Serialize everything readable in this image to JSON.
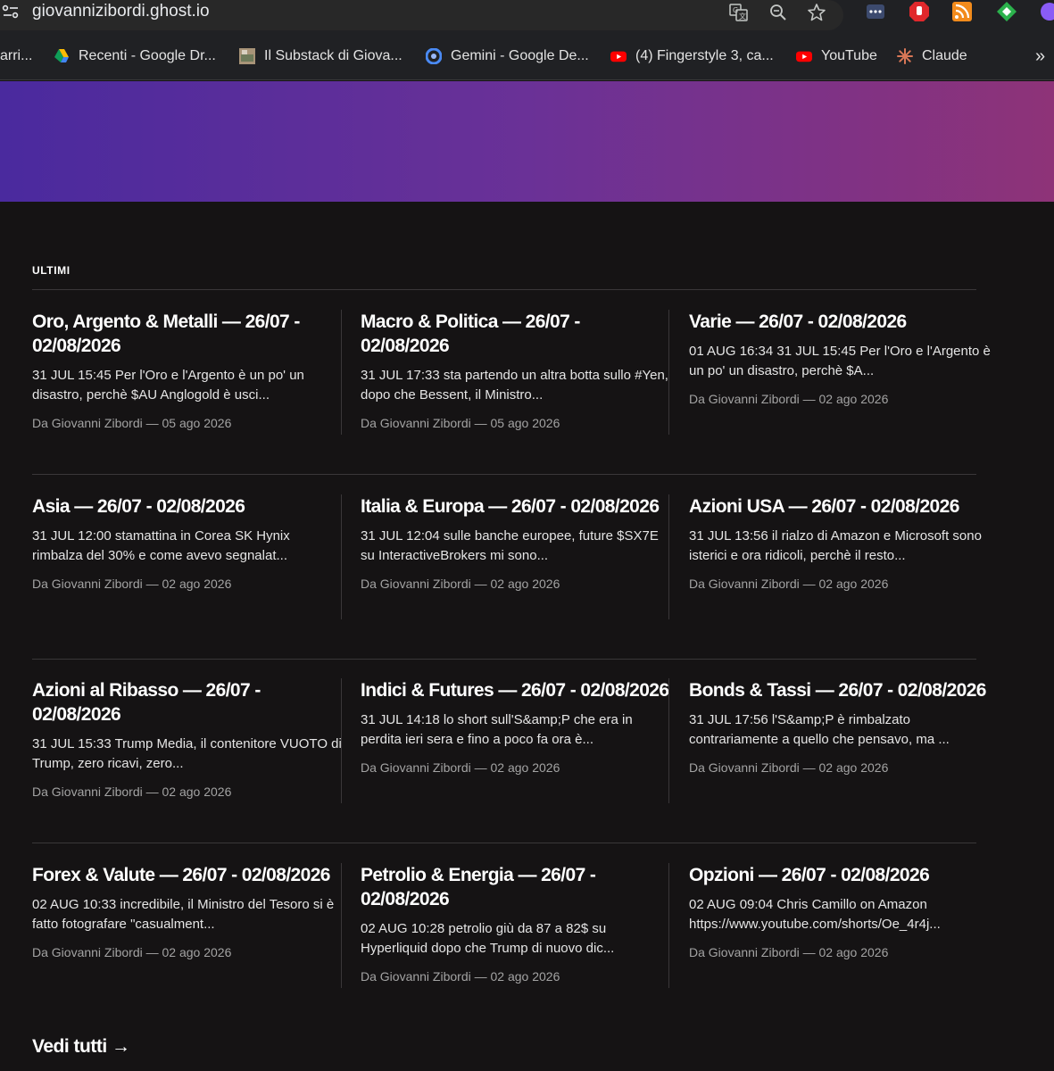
{
  "browser": {
    "url": "giovannizibordi.ghost.io",
    "bookmarks": [
      {
        "label": "arri..."
      },
      {
        "label": "Recenti - Google Dr..."
      },
      {
        "label": "Il Substack di Giova..."
      },
      {
        "label": "Gemini - Google De..."
      },
      {
        "label": "(4) Fingerstyle 3, ca..."
      },
      {
        "label": "YouTube"
      },
      {
        "label": "Claude"
      }
    ],
    "overflow_label": "»"
  },
  "section": {
    "title": "ULTIMI"
  },
  "posts": [
    {
      "title": "Oro, Argento & Metalli — 26/07 - 02/08/2026",
      "excerpt": "31 JUL 15:45 Per l'Oro e l'Argento è un po' un disastro, perchè $AU Anglogold è usci...",
      "meta": "Da Giovanni Zibordi — 05 ago 2026"
    },
    {
      "title": "Macro & Politica — 26/07 - 02/08/2026",
      "excerpt": "31 JUL 17:33 sta partendo un altra botta sullo #Yen, dopo che Bessent, il Ministro...",
      "meta": "Da Giovanni Zibordi — 05 ago 2026"
    },
    {
      "title": "Varie — 26/07 - 02/08/2026",
      "excerpt": "01 AUG 16:34 31 JUL 15:45 Per l'Oro e l'Argento è un po' un disastro, perchè $A...",
      "meta": "Da Giovanni Zibordi — 02 ago 2026"
    },
    {
      "title": "Asia — 26/07 - 02/08/2026",
      "excerpt": "31 JUL 12:00 stamattina in Corea SK Hynix rimbalza del 30% e come avevo segnalat...",
      "meta": "Da Giovanni Zibordi — 02 ago 2026"
    },
    {
      "title": "Italia & Europa — 26/07 - 02/08/2026",
      "excerpt": "31 JUL 12:04 sulle banche europee, future $SX7E su InteractiveBrokers mi sono...",
      "meta": "Da Giovanni Zibordi — 02 ago 2026"
    },
    {
      "title": "Azioni USA — 26/07 - 02/08/2026",
      "excerpt": "31 JUL 13:56 il rialzo di Amazon e Microsoft sono isterici e ora ridicoli, perchè il resto...",
      "meta": "Da Giovanni Zibordi — 02 ago 2026"
    },
    {
      "title": "Azioni al Ribasso — 26/07 - 02/08/2026",
      "excerpt": "31 JUL 15:33 Trump Media, il contenitore VUOTO di Trump, zero ricavi, zero...",
      "meta": "Da Giovanni Zibordi — 02 ago 2026"
    },
    {
      "title": "Indici & Futures — 26/07 - 02/08/2026",
      "excerpt": "31 JUL 14:18 lo short sull'S&amp;P che era in perdita ieri sera e fino a poco fa ora è...",
      "meta": "Da Giovanni Zibordi — 02 ago 2026"
    },
    {
      "title": "Bonds & Tassi — 26/07 - 02/08/2026",
      "excerpt": "31 JUL 17:56 l'S&amp;P è rimbalzato contrariamente a quello che pensavo, ma ...",
      "meta": "Da Giovanni Zibordi — 02 ago 2026"
    },
    {
      "title": "Forex & Valute — 26/07 - 02/08/2026",
      "excerpt": "02 AUG 10:33 incredibile, il Ministro del Tesoro si è fatto fotografare \"casualment...",
      "meta": "Da Giovanni Zibordi — 02 ago 2026"
    },
    {
      "title": "Petrolio & Energia — 26/07 - 02/08/2026",
      "excerpt": "02 AUG 10:28 petrolio giù da 87 a 82$ su Hyperliquid dopo che Trump di nuovo dic...",
      "meta": "Da Giovanni Zibordi — 02 ago 2026"
    },
    {
      "title": "Opzioni — 26/07 - 02/08/2026",
      "excerpt": "02 AUG 09:04 Chris Camillo on Amazon https://www.youtube.com/shorts/Oe_4r4j...",
      "meta": "Da Giovanni Zibordi — 02 ago 2026"
    }
  ],
  "see_all": {
    "label": "Vedi tutti →"
  },
  "colors": {
    "banner_start": "#4a2a9e",
    "banner_end": "#8e3378",
    "page_bg": "#151314"
  }
}
